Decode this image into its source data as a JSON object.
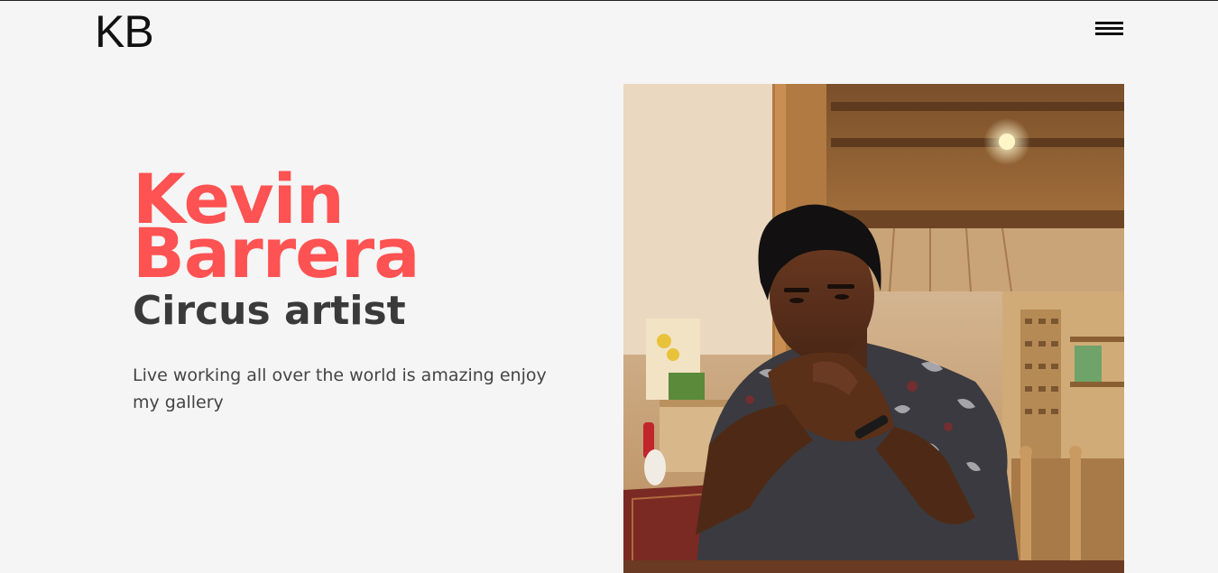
{
  "header": {
    "logo": "KB",
    "menu_icon": "hamburger-menu-icon"
  },
  "hero": {
    "name_first": "Kevin",
    "name_last": "Barrera",
    "role": "Circus artist",
    "description": "Live working all over the world is amazing enjoy my gallery"
  },
  "photo": {
    "subject": "portrait-photo"
  },
  "colors": {
    "accent": "#ff5252",
    "text_dark": "#3a3a3a",
    "background": "#f5f5f5"
  }
}
